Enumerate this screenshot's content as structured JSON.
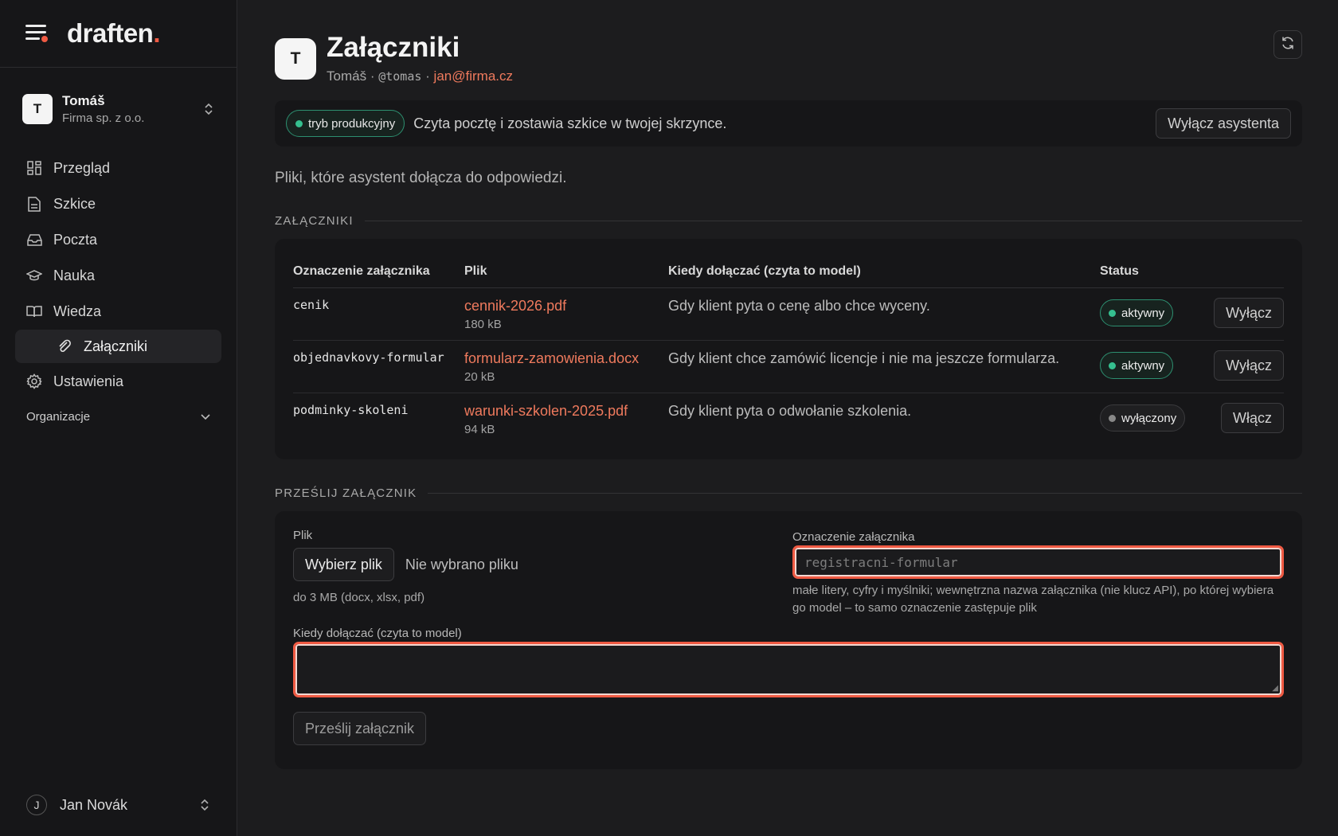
{
  "brand": {
    "name": "draften",
    "dot": "."
  },
  "account": {
    "initial": "T",
    "name": "Tomáš",
    "org": "Firma sp. z o.o."
  },
  "nav": {
    "items": [
      {
        "label": "Przegląd"
      },
      {
        "label": "Szkice"
      },
      {
        "label": "Poczta"
      },
      {
        "label": "Nauka"
      },
      {
        "label": "Wiedza"
      },
      {
        "label": "Załączniki"
      },
      {
        "label": "Ustawienia"
      }
    ],
    "section": "Organizacje"
  },
  "user": {
    "initial": "J",
    "name": "Jan Novák"
  },
  "header": {
    "initial": "T",
    "title": "Załączniki",
    "name": "Tomáš",
    "separator": "·",
    "handle": "@tomas",
    "email": "jan@firma.cz"
  },
  "banner": {
    "pill": "tryb produkcyjny",
    "message": "Czyta pocztę i zostawia szkice w twojej skrzynce.",
    "button": "Wyłącz asystenta"
  },
  "description": "Pliki, które asystent dołącza do odpowiedzi.",
  "attachments_section": {
    "label": "ZAŁĄCZNIKI",
    "columns": [
      "Oznaczenie załącznika",
      "Plik",
      "Kiedy dołączać (czyta to model)",
      "Status"
    ],
    "rows": [
      {
        "key": "cenik",
        "file": "cennik-2026.pdf",
        "size": "180 kB",
        "when": "Gdy klient pyta o cenę albo chce wyceny.",
        "status": "aktywny",
        "action": "Wyłącz"
      },
      {
        "key": "objednavkovy-formular",
        "file": "formularz-zamowienia.docx",
        "size": "20 kB",
        "when": "Gdy klient chce zamówić licencje i nie ma jeszcze formularza.",
        "status": "aktywny",
        "action": "Wyłącz"
      },
      {
        "key": "podminky-skoleni",
        "file": "warunki-szkolen-2025.pdf",
        "size": "94 kB",
        "when": "Gdy klient pyta o odwołanie szkolenia.",
        "status": "wyłączony",
        "action": "Włącz"
      }
    ]
  },
  "upload_section": {
    "label": "PRZEŚLIJ ZAŁĄCZNIK",
    "file_label": "Plik",
    "choose_button": "Wybierz plik",
    "no_file": "Nie wybrano pliku",
    "file_hint": "do 3 MB (docx, xlsx, pdf)",
    "key_label": "Oznaczenie załącznika",
    "key_placeholder": "registracni-formular",
    "key_hint": "małe litery, cyfry i myślniki; wewnętrzna nazwa załącznika (nie klucz API), po której wybiera go model – to samo oznaczenie zastępuje plik",
    "when_label": "Kiedy dołączać (czyta to model)",
    "submit": "Prześlij załącznik"
  },
  "colors": {
    "accent": "#ef5a43",
    "link": "#ef7a5d",
    "active": "#35c08f"
  }
}
